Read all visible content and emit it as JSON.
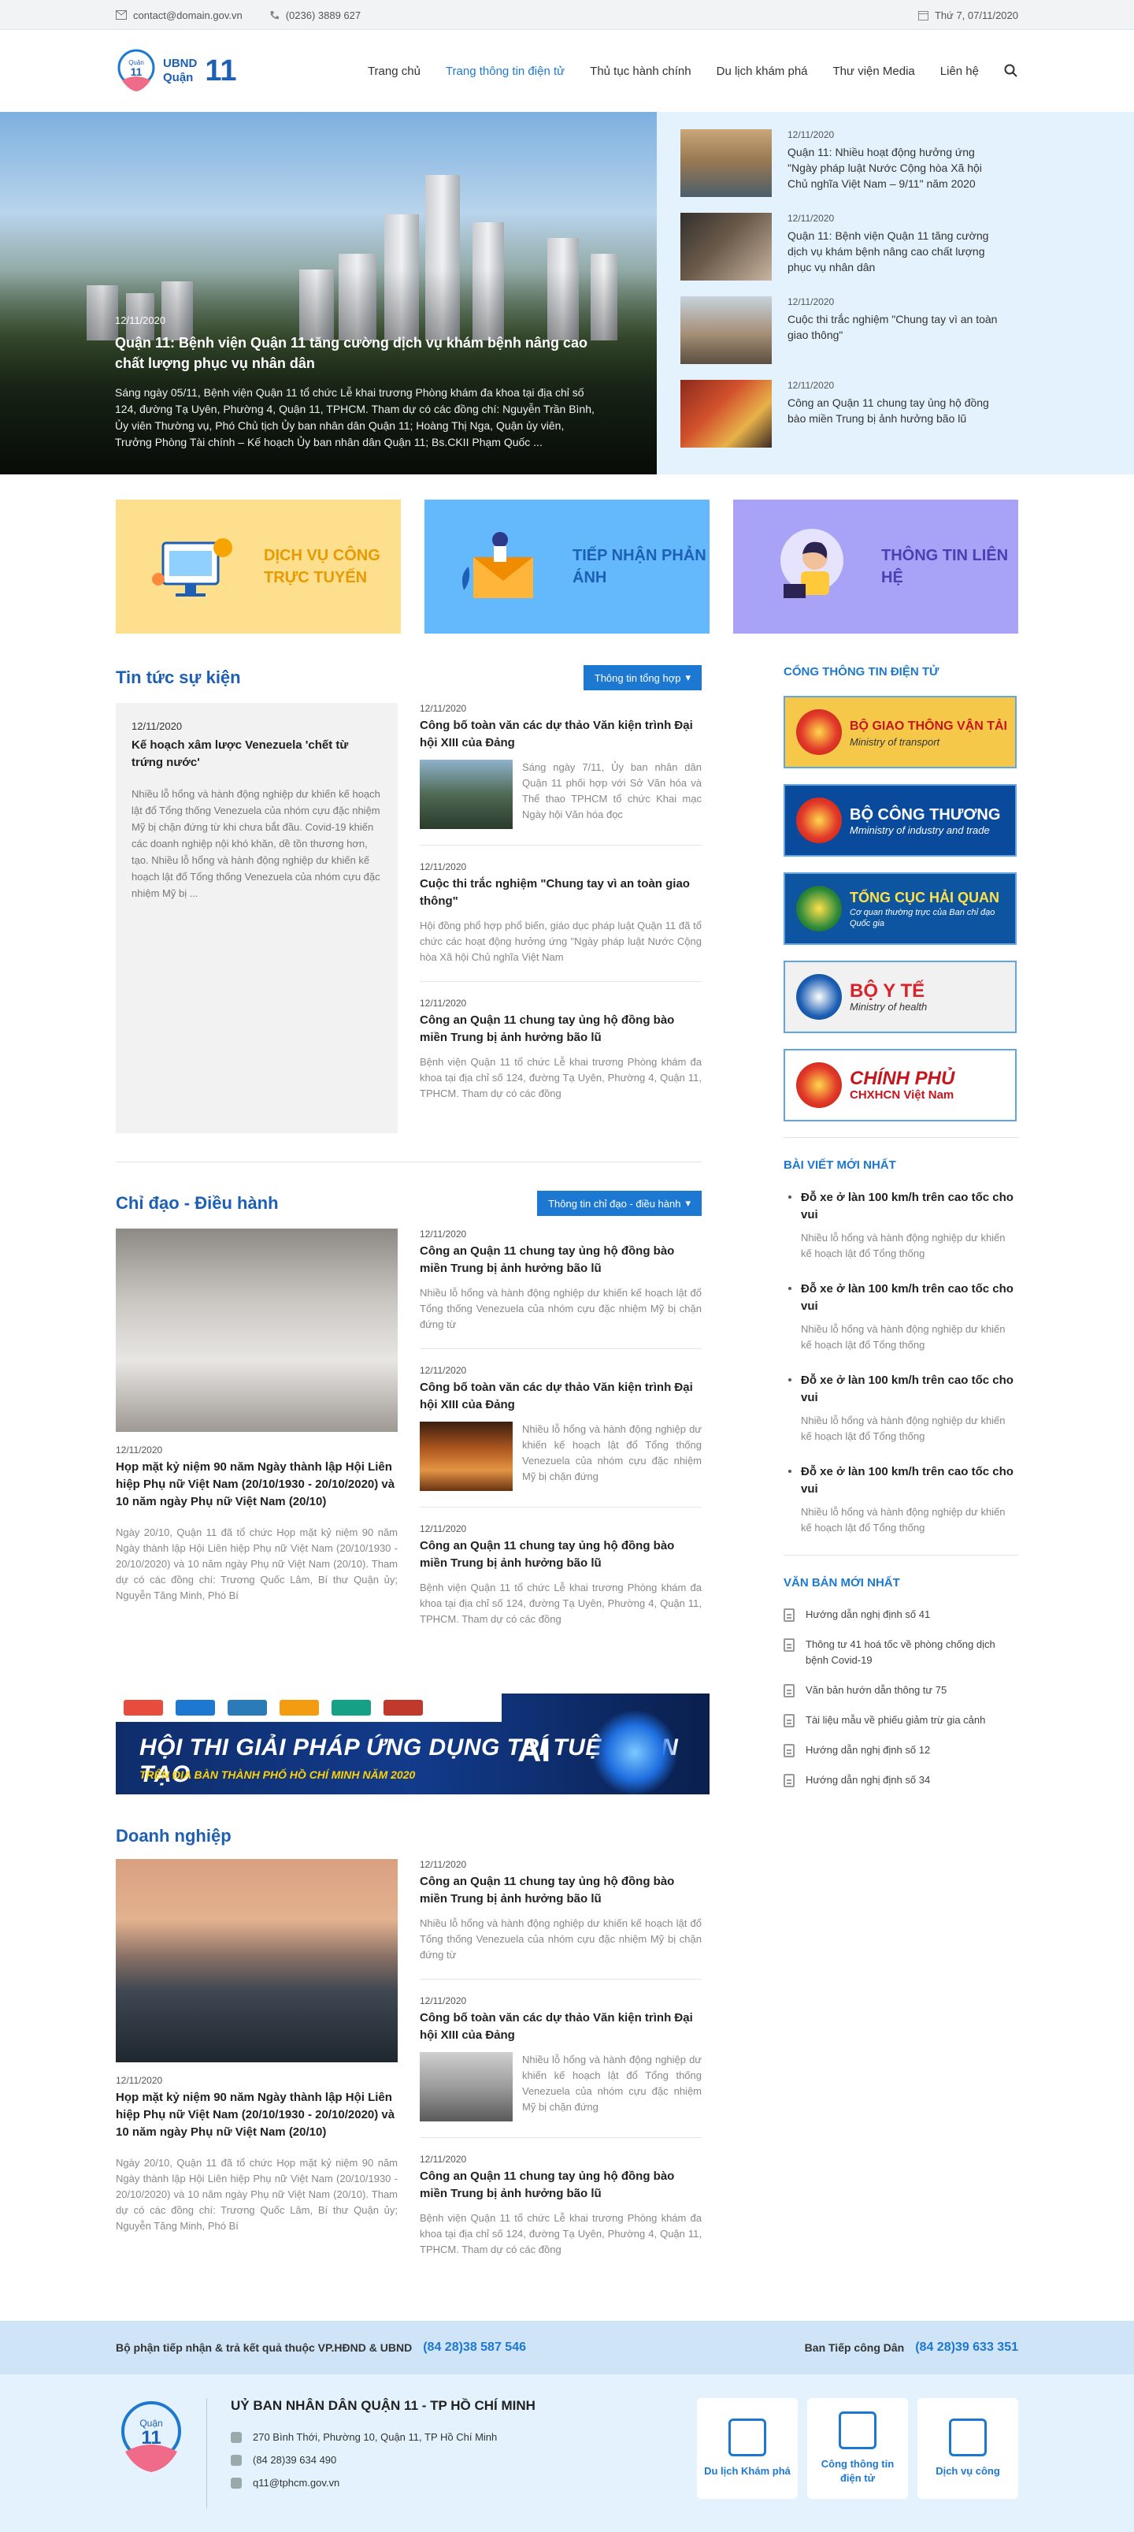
{
  "topbar": {
    "email": "contact@domain.gov.vn",
    "phone": "(0236) 3889 627",
    "date": "Thứ 7, 07/11/2020"
  },
  "logo": {
    "line1": "UBND",
    "line2": "Quận",
    "number": "11",
    "emblem_text": "Quận",
    "emblem_number": "11"
  },
  "nav": {
    "items": [
      "Trang chủ",
      "Trang thông tin điện tử",
      "Thủ tục hành chính",
      "Du lịch khám phá",
      "Thư viện Media",
      "Liên hệ"
    ],
    "active_index": 1
  },
  "hero": {
    "main": {
      "date": "12/11/2020",
      "title": "Quận 11: Bệnh viện Quận 11 tăng cường dịch vụ khám bệnh nâng cao chất lượng phục vụ nhân dân",
      "summary": "Sáng ngày 05/11, Bệnh viện Quận 11 tổ chức Lễ khai trương Phòng khám đa khoa tại địa chỉ số 124, đường Tạ Uyên, Phường 4, Quận 11, TPHCM. Tham dự có các đồng chí: Nguyễn Trần Bình, Ủy viên Thường vụ, Phó Chủ tịch Ủy ban nhân dân Quận 11; Hoàng Thị Nga, Quận ủy viên, Trưởng Phòng Tài chính – Kế hoạch Ủy ban nhân dân Quận 11; Bs.CKII Phạm Quốc ..."
    },
    "side": [
      {
        "date": "12/11/2020",
        "title": "Quận 11: Nhiều hoạt động hưởng ứng \"Ngày pháp luật Nước Cộng hòa Xã hội Chủ nghĩa Việt Nam – 9/11\" năm 2020"
      },
      {
        "date": "12/11/2020",
        "title": "Quận 11: Bệnh viện Quận 11 tăng cường dịch vụ khám bệnh nâng cao chất lượng phục vụ nhân dân"
      },
      {
        "date": "12/11/2020",
        "title": "Cuộc thi trắc nghiệm \"Chung tay vì an toàn giao thông\""
      },
      {
        "date": "12/11/2020",
        "title": "Công an Quận 11 chung tay ủng hộ đồng bào miền Trung bị ảnh hưởng bão lũ"
      }
    ]
  },
  "services": [
    {
      "label": "Dịch vụ công trực tuyến",
      "color": "#f2a400",
      "bg": "#fddf8e"
    },
    {
      "label": "Tiếp nhận phản ánh",
      "color": "#1d5fb4",
      "bg": "#63b9fb"
    },
    {
      "label": "Thông tin liên hệ",
      "color": "#4a3fb5",
      "bg": "#a9a3f7"
    }
  ],
  "news": {
    "title": "Tin tức sự kiện",
    "button": "Thông tin tổng hợp",
    "featured": {
      "date": "12/11/2020",
      "title": "Kế hoạch xâm lược Venezuela 'chết từ trứng nước'",
      "summary": "Nhiều lỗ hổng và hành động nghiệp dư khiến kế hoạch lật đổ Tổng thống Venezuela của nhóm cựu đặc nhiệm Mỹ bị chặn đứng từ khi chưa bắt đầu. Covid-19 khiến các doanh nghiệp nội khó khăn, dề tồn thương hơn, tạo. Nhiều lỗ hổng và hành động nghiệp dư khiến kế hoạch lật đổ Tổng thống Venezuela của nhóm cựu đặc nhiệm Mỹ bị ..."
    },
    "items": [
      {
        "date": "12/11/2020",
        "title": "Công bố toàn văn các dự thảo Văn kiện trình Đại hội XIII của Đảng",
        "summary": "Sáng ngày 7/11, Ủy ban nhân dân Quận 11 phối hợp với Sở Văn hóa và Thể thao TPHCM tổ chức Khai mạc Ngày hội Văn hóa đọc"
      },
      {
        "date": "12/11/2020",
        "title": "Cuộc thi trắc nghiệm \"Chung tay vì an toàn giao thông\"",
        "summary": "Hội đồng phổ hợp phổ biến, giáo dục pháp luật Quận 11 đã tổ chức các hoạt động hưởng ứng \"Ngày pháp luật Nước Cộng hòa Xã hội Chủ nghĩa Việt Nam"
      },
      {
        "date": "12/11/2020",
        "title": "Công an Quận 11 chung tay ủng hộ đồng bào miền Trung bị ảnh hưởng bão lũ",
        "summary": "Bệnh viện Quận 11 tổ chức Lễ khai trương Phòng khám đa khoa tại địa chỉ số 124, đường Tạ Uyên, Phường 4, Quận 11, TPHCM. Tham dự có các đồng"
      }
    ]
  },
  "directive": {
    "title": "Chỉ đạo - Điều hành",
    "button": "Thông tin chỉ đạo - điều hành",
    "featured": {
      "date": "12/11/2020",
      "title": "Họp mặt kỷ niệm 90 năm Ngày thành lập Hội Liên hiệp Phụ nữ Việt Nam (20/10/1930 - 20/10/2020) và 10 năm ngày Phụ nữ Việt Nam (20/10)",
      "summary": "Ngày 20/10, Quận 11 đã tổ chức Họp mặt kỷ niệm 90 năm Ngày thành lập Hội Liên hiệp Phụ nữ Việt Nam (20/10/1930 - 20/10/2020) và 10 năm ngày Phụ nữ Việt Nam (20/10). Tham dự có các đồng chí: Trương Quốc Lâm, Bí thư Quận ủy; Nguyễn Tăng Minh, Phó Bí"
    },
    "items": [
      {
        "date": "12/11/2020",
        "title": "Công an Quận 11 chung tay ủng hộ đồng bào miền Trung bị ảnh hưởng bão lũ",
        "summary": "Nhiều lỗ hổng và hành động nghiệp dư khiến kế hoạch lật đổ Tổng thống Venezuela của nhóm cựu đặc nhiệm Mỹ bị chặn đứng từ"
      },
      {
        "date": "12/11/2020",
        "title": "Công bố toàn văn các dự thảo Văn kiện trình Đại hội XIII của Đảng",
        "summary": "Nhiều lỗ hổng và hành động nghiệp dư khiến kế hoạch lật đổ Tổng thống Venezuela của nhóm cựu đặc nhiệm Mỹ bị chặn đứng"
      },
      {
        "date": "12/11/2020",
        "title": "Công an Quận 11 chung tay ủng hộ đồng bào miền Trung bị ảnh hưởng bão lũ",
        "summary": "Bệnh viện Quận 11 tổ chức Lễ khai trương Phòng khám đa khoa tại địa chỉ số 124, đường Tạ Uyên, Phường 4, Quận 11, TPHCM. Tham dự có các đồng"
      }
    ]
  },
  "banner": {
    "title": "HỘI THI GIẢI PHÁP ỨNG DỤNG TRÍ TUỆ NHÂN TẠO",
    "subtitle": "TRÊN ĐỊA BÀN THÀNH PHỐ HỒ CHÍ MINH NĂM 2020",
    "mark": "AI"
  },
  "business": {
    "title": "Doanh nghiệp",
    "featured": {
      "date": "12/11/2020",
      "title": "Họp mặt kỷ niệm 90 năm Ngày thành lập Hội Liên hiệp Phụ nữ Việt Nam (20/10/1930 - 20/10/2020) và 10 năm ngày Phụ nữ Việt Nam (20/10)",
      "summary": "Ngày 20/10, Quận 11 đã tổ chức Họp mặt kỷ niệm 90 năm Ngày thành lập Hội Liên hiệp Phụ nữ Việt Nam (20/10/1930 - 20/10/2020) và 10 năm ngày Phụ nữ Việt Nam (20/10). Tham dự có các đồng chí: Trương Quốc Lâm, Bí thư Quận ủy; Nguyễn Tăng Minh, Phó Bí"
    },
    "items": [
      {
        "date": "12/11/2020",
        "title": "Công an Quận 11 chung tay ủng hộ đồng bào miền Trung bị ảnh hưởng bão lũ",
        "summary": "Nhiều lỗ hổng và hành động nghiệp dư khiến kế hoạch lật đổ Tổng thống Venezuela của nhóm cựu đặc nhiệm Mỹ bị chặn đứng từ"
      },
      {
        "date": "12/11/2020",
        "title": "Công bố toàn văn các dự thảo Văn kiện trình Đại hội XIII của Đảng",
        "summary": "Nhiều lỗ hổng và hành động nghiệp dư khiến kế hoạch lật đổ Tổng thống Venezuela của nhóm cựu đặc nhiệm Mỹ bị chặn đứng"
      },
      {
        "date": "12/11/2020",
        "title": "Công an Quận 11 chung tay ủng hộ đồng bào miền Trung bị ảnh hưởng bão lũ",
        "summary": "Bệnh viện Quận 11 tổ chức Lễ khai trương Phòng khám đa khoa tại địa chỉ số 124, đường Tạ Uyên, Phường 4, Quận 11, TPHCM. Tham dự có các đồng"
      }
    ]
  },
  "sidebar": {
    "portal_title": "Cổng thông tin điện tử",
    "links": [
      {
        "title": "BỘ GIAO THÔNG VẬN TẢI",
        "sub": "Ministry of transport",
        "bg": "#f6c84a",
        "color": "#c5161d"
      },
      {
        "title": "BỘ CÔNG THƯƠNG",
        "sub": "Mministry of industry and trade",
        "bg": "#0a4a9c",
        "color": "#ffffff"
      },
      {
        "title": "TỔNG CỤC HẢI QUAN",
        "sub": "Cơ quan thường trực của Ban chỉ đạo Quốc gia",
        "bg": "#0d55a0",
        "color": "#ffe14a"
      },
      {
        "title": "BỘ Y TẾ",
        "sub": "Ministry of health",
        "bg": "#f1f1f1",
        "color": "#d8232a"
      },
      {
        "title": "CHÍNH PHỦ",
        "sub": "CHXHCN Việt Nam",
        "bg": "#ffffff",
        "color": "#c5161d"
      }
    ],
    "latest_title": "Bài viết mới nhất",
    "latest": [
      {
        "title": "Đỗ xe ở làn 100 km/h trên cao tốc cho vui",
        "summary": "Nhiều lỗ hổng và hành động nghiệp dư khiến kế hoạch lật đổ Tổng thống"
      },
      {
        "title": "Đỗ xe ở làn 100 km/h trên cao tốc cho vui",
        "summary": "Nhiều lỗ hổng và hành động nghiệp dư khiến kế hoạch lật đổ Tổng thống"
      },
      {
        "title": "Đỗ xe ở làn 100 km/h trên cao tốc cho vui",
        "summary": "Nhiều lỗ hổng và hành động nghiệp dư khiến kế hoạch lật đổ Tổng thống"
      },
      {
        "title": "Đỗ xe ở làn 100 km/h trên cao tốc cho vui",
        "summary": "Nhiều lỗ hổng và hành động nghiệp dư khiến kế hoạch lật đổ Tổng thống"
      }
    ],
    "docs_title": "Văn bản mới nhất",
    "docs": [
      "Hướng dẫn nghị định số 41",
      "Thông tư 41 hoá tốc về phòng chống dịch bệnh Covid-19",
      "Văn bản hướn dẫn thông tư 75",
      "Tài liệu mẫu về phiếu giảm trừ gia cảnh",
      "Hướng dẫn nghị định số 12",
      "Hướng dẫn nghị định số 34"
    ]
  },
  "footer_bar": {
    "left_label": "Bộ phận tiếp nhận & trả kết quả thuộc VP.HĐND & UBND",
    "left_phone": "(84 28)38 587 546",
    "right_label": "Ban Tiếp công Dân",
    "right_phone": "(84 28)39 633 351"
  },
  "footer": {
    "org": "UỶ BAN NHÂN DÂN QUẬN 11 - TP HỒ CHÍ MINH",
    "address": "270 Bình Thới, Phường 10, Quận 11, TP Hồ Chí Minh",
    "phone": "(84 28)39 634 490",
    "email": "q11@tphcm.gov.vn",
    "cards": [
      "Du lịch Khám phá",
      "Công thông tin điện tử",
      "Dịch vụ công"
    ]
  }
}
